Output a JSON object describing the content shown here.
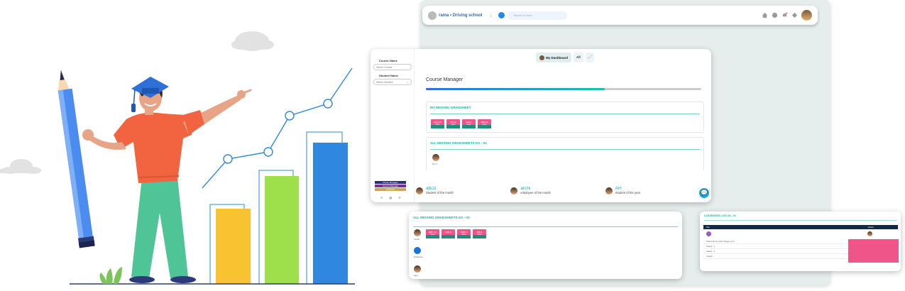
{
  "header": {
    "brand": "rama • Driving school",
    "search_placeholder": "Search in front",
    "icons": [
      "home-icon",
      "chat-icon",
      "bell-icon",
      "diamond-icon",
      "user-avatar"
    ]
  },
  "sidebar": {
    "course_label": "Course Name",
    "course_placeholder": "Select Course",
    "student_label": "Student Name",
    "student_placeholder": "Select Student",
    "legend": [
      {
        "label": "Phase Manager",
        "color": "#2b2d7e"
      },
      {
        "label": "Course Manager",
        "color": "#7a2c8f"
      },
      {
        "label": "Instructor",
        "color": "#caa25a"
      }
    ]
  },
  "dashboard": {
    "tabs": {
      "my": "My Dashboard",
      "all": "All"
    },
    "title": "Course Manager",
    "progress": 0.65,
    "missing_section": {
      "title": "MY MISSING GRADSHEET",
      "chips": [
        {
          "code": "APR-TO",
          "status": "Short"
        },
        {
          "code": "DPR-9",
          "status": "Short"
        },
        {
          "code": "SCR-1",
          "status": "Short"
        },
        {
          "code": "ABR-De",
          "status": "Short"
        }
      ]
    },
    "all_section": {
      "title": "ALL MISSING GRADSHEETS DA - 03",
      "student": "abcd"
    },
    "awards": [
      {
        "name": "abcd",
        "title": "Student of the month"
      },
      {
        "name": "archi",
        "title": "employee of the month"
      },
      {
        "name": "AH",
        "title": "Student of the year"
      }
    ]
  },
  "card_all": {
    "title": "ALL MISSING GRADSHEETS DA - 03",
    "students": [
      {
        "name": "coach",
        "chips": [
          {
            "code": "APR - 10",
            "status": "Short"
          },
          {
            "code": "APR-9",
            "status": ""
          },
          {
            "code": "SGR-3",
            "status": "Short"
          },
          {
            "code": "IDR-1",
            "status": "Short"
          }
        ]
      },
      {
        "name": "Studyone",
        "chips": []
      },
      {
        "name": "Lani",
        "chips": []
      }
    ]
  },
  "card_clearance": {
    "title": "CLEARANCE LOG DA - 03",
    "columns": [
      "File",
      "Action"
    ],
    "rows": [
      "Stand Alone (ask) Stage Cont",
      "Stand - 1",
      "Stand - 2",
      "Insight"
    ]
  },
  "colors": {
    "teal": "#19b1a1",
    "pink": "#f0558a",
    "blue": "#2f6db5",
    "bar_yellow": "#f7c331",
    "bar_green": "#9ee04c",
    "bar_blue": "#2f88dd",
    "shirt": "#f26440",
    "pants": "#4fc496"
  }
}
